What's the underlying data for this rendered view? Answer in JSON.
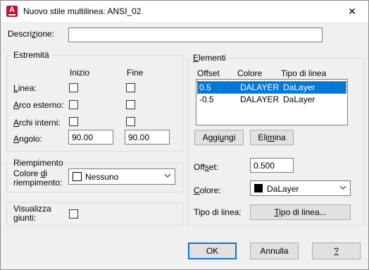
{
  "window": {
    "title": "Nuovo stile multilinea: ANSI_02",
    "close_glyph": "✕",
    "app_icon_letter": "A"
  },
  "description": {
    "label": "Descrizione:",
    "value": ""
  },
  "caps": {
    "legend": "Estremità",
    "col_start": "Inizio",
    "col_end": "Fine",
    "line_label": "Linea:",
    "outer_arc_label": "Arco esterno:",
    "inner_arcs_label": "Archi interni:",
    "angle_label": "Angolo:",
    "angle_start": "90.00",
    "angle_end": "90.00"
  },
  "fill": {
    "legend": "Riempimento",
    "color_label_1": "Colore di",
    "color_label_2": "riempimento:",
    "color_value": "Nessuno"
  },
  "joints": {
    "label_1": "Visualizza",
    "label_2": "giunti:"
  },
  "elements": {
    "legend": "Elementi",
    "headers": [
      "Offset",
      "Colore",
      "Tipo di linea"
    ],
    "rows": [
      {
        "offset": "0.5",
        "color": "DALAYER",
        "linetype": "DaLayer",
        "selected": true
      },
      {
        "offset": "-0.5",
        "color": "DALAYER",
        "linetype": "DaLayer",
        "selected": false
      }
    ],
    "add_button": "Aggiungi",
    "delete_button": "Elimina",
    "offset_label": "Offset:",
    "offset_value": "0.500",
    "color_label": "Colore:",
    "color_value": "DaLayer",
    "color_swatch": "#000000",
    "linetype_label": "Tipo di linea:",
    "linetype_button": "Tipo di linea..."
  },
  "footer": {
    "ok": "OK",
    "cancel": "Annulla",
    "help": "?"
  },
  "colors": {
    "accent": "#0078d7",
    "brand": "#c8102e"
  }
}
